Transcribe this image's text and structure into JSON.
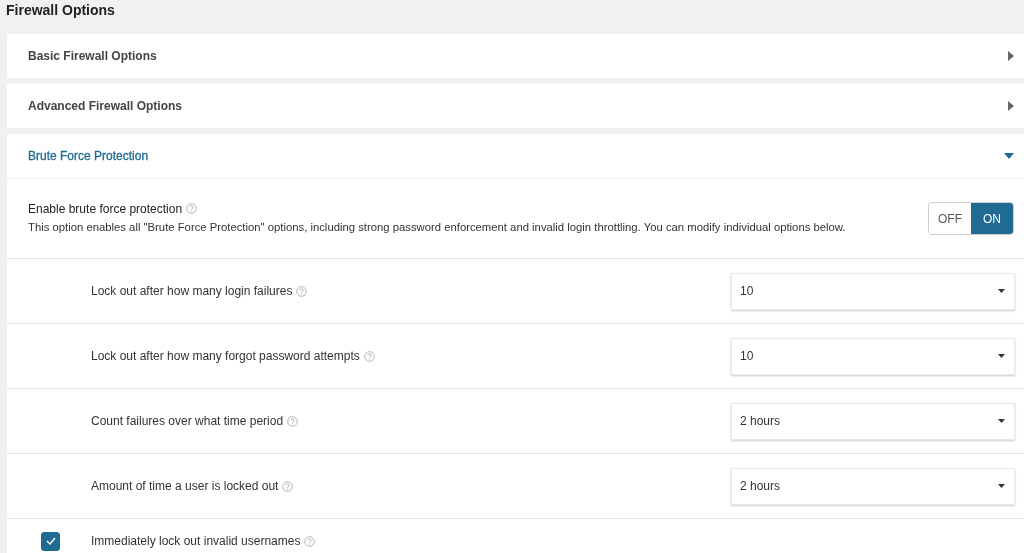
{
  "page_title": "Firewall Options",
  "sections": [
    {
      "title": "Basic Firewall Options",
      "expanded": false
    },
    {
      "title": "Advanced Firewall Options",
      "expanded": false
    },
    {
      "title": "Brute Force Protection",
      "expanded": true
    }
  ],
  "brute_force": {
    "enable": {
      "label": "Enable brute force protection",
      "description": "This option enables all \"Brute Force Protection\" options, including strong password enforcement and invalid login throttling. You can modify individual options below.",
      "toggle": [
        {
          "label": "OFF",
          "selected": false
        },
        {
          "label": "ON",
          "selected": true
        }
      ]
    },
    "options": [
      {
        "kind": "select",
        "label": "Lock out after how many login failures",
        "value": "10"
      },
      {
        "kind": "select",
        "label": "Lock out after how many forgot password attempts",
        "value": "10"
      },
      {
        "kind": "select",
        "label": "Count failures over what time period",
        "value": "2 hours"
      },
      {
        "kind": "select",
        "label": "Amount of time a user is locked out",
        "value": "2 hours"
      },
      {
        "kind": "checkbox",
        "label": "Immediately lock out invalid usernames",
        "checked": true
      }
    ]
  }
}
